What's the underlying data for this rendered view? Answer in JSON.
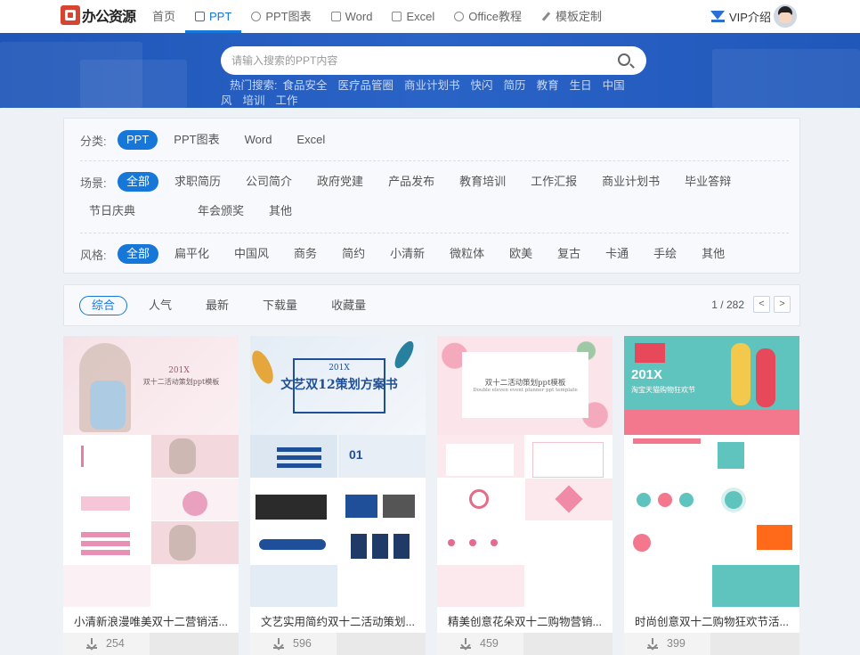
{
  "brand": {
    "name": "办公资源"
  },
  "nav": {
    "items": [
      {
        "label": "首页",
        "icon": "none"
      },
      {
        "label": "PPT",
        "icon": "ppt-icon",
        "active": true
      },
      {
        "label": "PPT图表",
        "icon": "chart-pie-icon"
      },
      {
        "label": "Word",
        "icon": "word-icon"
      },
      {
        "label": "Excel",
        "icon": "excel-icon"
      },
      {
        "label": "Office教程",
        "icon": "play-icon"
      },
      {
        "label": "模板定制",
        "icon": "pen-icon"
      }
    ],
    "vip_label": "VIP介绍"
  },
  "search": {
    "placeholder": "请输入搜索的PPT内容"
  },
  "hot_search": {
    "label": "热门搜索:",
    "terms": [
      "食品安全",
      "医疗品管圈",
      "商业计划书",
      "快闪",
      "简历",
      "教育",
      "生日",
      "中国风",
      "培训",
      "工作"
    ]
  },
  "filters": {
    "category": {
      "label": "分类:",
      "options": [
        "PPT",
        "PPT图表",
        "Word",
        "Excel"
      ],
      "selected": "PPT"
    },
    "scene": {
      "label": "场景:",
      "options": [
        "全部",
        "求职简历",
        "公司简介",
        "政府党建",
        "产品发布",
        "教育培训",
        "工作汇报",
        "商业计划书",
        "毕业答辩",
        "节日庆典",
        "年会颁奖",
        "其他"
      ],
      "selected": "全部"
    },
    "style": {
      "label": "风格:",
      "options": [
        "全部",
        "扁平化",
        "中国风",
        "商务",
        "简约",
        "小清新",
        "微粒体",
        "欧美",
        "复古",
        "卡通",
        "手绘",
        "其他"
      ],
      "selected": "全部"
    }
  },
  "sort": {
    "options": [
      "综合",
      "人气",
      "最新",
      "下载量",
      "收藏量"
    ],
    "selected": "综合",
    "page_text": "1 / 282",
    "prev": "<",
    "next": ">"
  },
  "cards": [
    {
      "title": "小清新浪漫唯美双十二营销活...",
      "downloads": "254",
      "cover": {
        "heading": "201X",
        "sub": "双十二活动策划ppt模板",
        "accent": "#e0719a"
      }
    },
    {
      "title": "文艺实用简约双十二活动策划...",
      "downloads": "596",
      "cover": {
        "heading": "201X",
        "sub": "文艺双12策划方案书",
        "accent": "#1f4f99"
      }
    },
    {
      "title": "精美创意花朵双十二购物营销...",
      "downloads": "459",
      "cover": {
        "heading": "双十二活动策划ppt模板",
        "sub": "Double eleven event planner ppt template",
        "accent": "#e56a8b"
      }
    },
    {
      "title": "时尚创意双十二购物狂欢节活...",
      "downloads": "399",
      "cover": {
        "heading": "201X",
        "sub": "淘宝天猫购物狂欢节",
        "accent": "#e8495a"
      }
    }
  ]
}
